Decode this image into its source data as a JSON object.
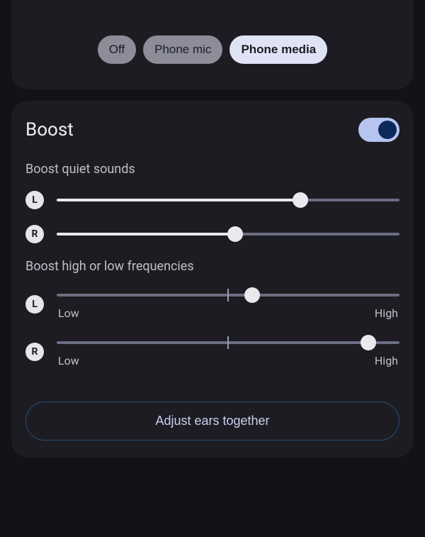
{
  "mode_selector": {
    "options": [
      {
        "label": "Off",
        "selected": false
      },
      {
        "label": "Phone mic",
        "selected": false
      },
      {
        "label": "Phone media",
        "selected": true
      }
    ]
  },
  "boost": {
    "title": "Boost",
    "enabled": true,
    "quiet_sounds": {
      "heading": "Boost quiet sounds",
      "left": {
        "badge": "L",
        "value": 71,
        "min": 0,
        "max": 100
      },
      "right": {
        "badge": "R",
        "value": 52,
        "min": 0,
        "max": 100
      }
    },
    "frequencies": {
      "heading": "Boost high or low frequencies",
      "low_label": "Low",
      "high_label": "High",
      "left": {
        "badge": "L",
        "value": 57,
        "min": 0,
        "max": 100
      },
      "right": {
        "badge": "R",
        "value": 91,
        "min": 0,
        "max": 100
      }
    },
    "adjust_button": "Adjust ears together"
  },
  "colors": {
    "background": "#131317",
    "card": "#1c1c22",
    "accent_toggle_track": "#b7c4f0",
    "accent_toggle_knob": "#0b2a5b",
    "slider_track": "#6b6d82",
    "slider_fill": "#e9e9ee",
    "text_primary": "#f0f0f0",
    "text_secondary": "#bfc0c7",
    "outline_button_border": "#2d4a7a"
  }
}
